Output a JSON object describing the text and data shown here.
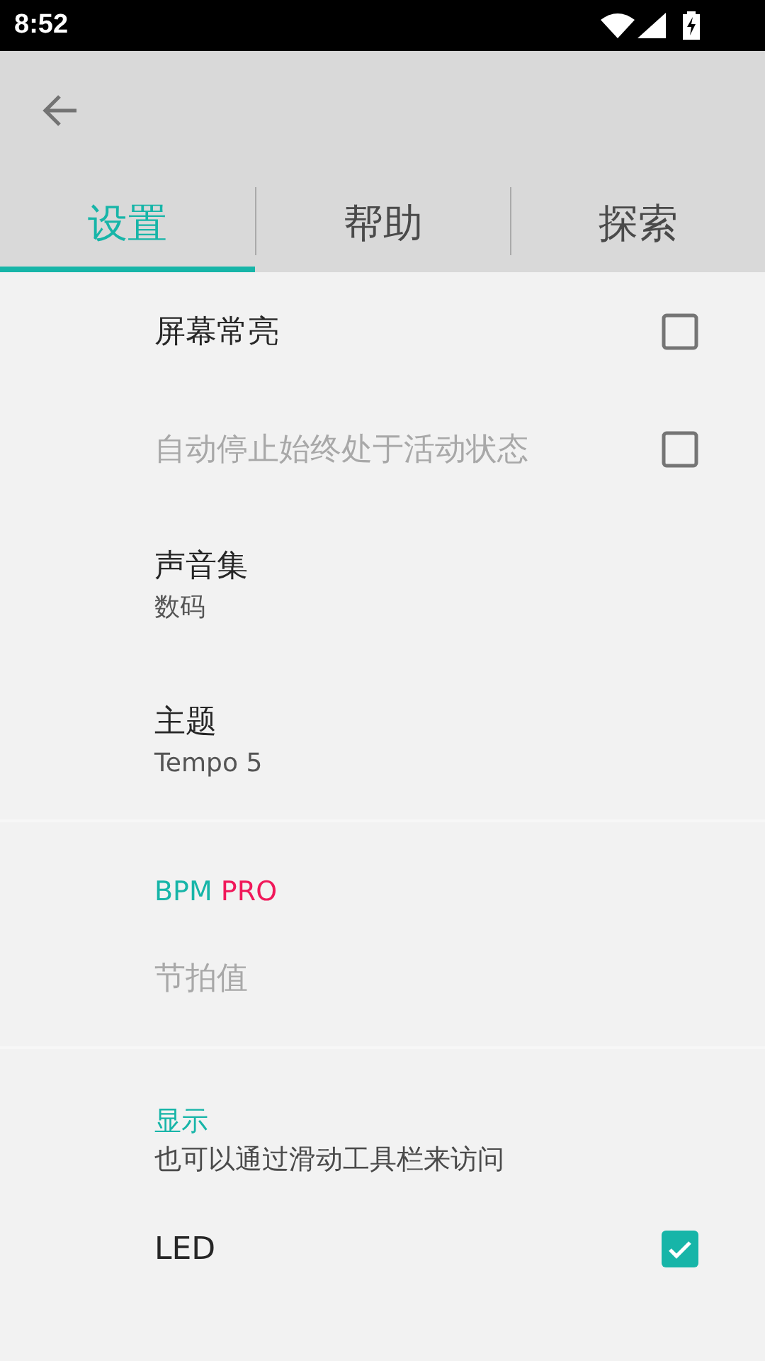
{
  "status_bar": {
    "time": "8:52"
  },
  "tabs": [
    {
      "label": "设置",
      "selected": true
    },
    {
      "label": "帮助",
      "selected": false
    },
    {
      "label": "探索",
      "selected": false
    }
  ],
  "sections": [
    {
      "items": [
        {
          "kind": "checkbox",
          "title": "屏幕常亮",
          "checked": false,
          "disabled": false
        },
        {
          "kind": "checkbox",
          "title": "自动停止始终处于活动状态",
          "checked": false,
          "disabled": true
        },
        {
          "kind": "value",
          "title": "声音集",
          "value": "数码"
        },
        {
          "kind": "value",
          "title": "主题",
          "value": "Tempo 5"
        }
      ]
    },
    {
      "header": [
        {
          "text": "BPM",
          "color": "#17b5a8"
        },
        {
          "text": "PRO",
          "color": "#f0185a"
        }
      ],
      "items": [
        {
          "kind": "plain",
          "title": "节拍值",
          "disabled": true
        }
      ]
    },
    {
      "header": [
        {
          "text": "显示",
          "color": "#17b5a8"
        }
      ],
      "summary": "也可以通过滑动工具栏来访问",
      "items": [
        {
          "kind": "checkbox",
          "title": "LED",
          "checked": true,
          "disabled": false
        }
      ]
    }
  ]
}
